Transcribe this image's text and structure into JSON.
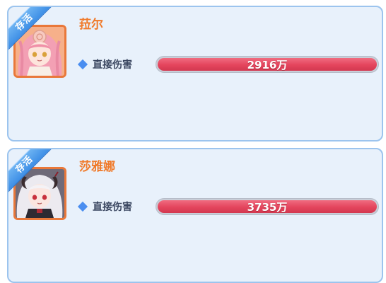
{
  "cards": [
    {
      "ribbon": "存活",
      "name": "菈尔",
      "stat_label": "直接伤害",
      "damage_text": "2916万",
      "damage_fill": 1.0,
      "avatar_icon": "pink-hair-character-portrait"
    },
    {
      "ribbon": "存活",
      "name": "莎雅娜",
      "stat_label": "直接伤害",
      "damage_text": "3735万",
      "damage_fill": 1.0,
      "avatar_icon": "white-hair-demon-character-portrait"
    }
  ],
  "colors": {
    "card_bg": "#e8f1fb",
    "card_border": "#9cc4ee",
    "name_orange": "#f07a2a",
    "bar_red": "#e4455d",
    "ribbon_blue": "#4a98ec"
  }
}
